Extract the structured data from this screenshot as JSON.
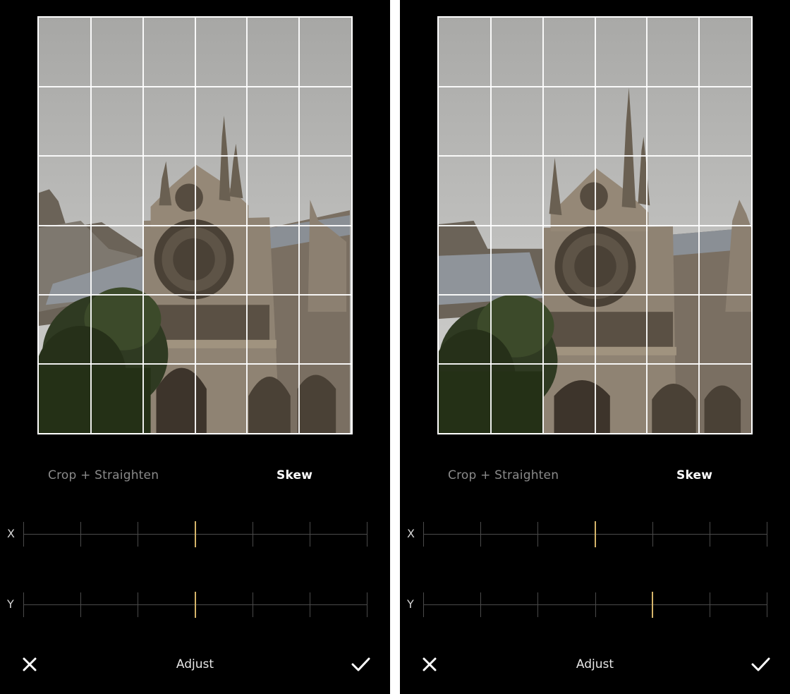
{
  "panels": [
    {
      "tabs": {
        "crop_straighten": "Crop + Straighten",
        "skew": "Skew",
        "active": "skew"
      },
      "sliders": [
        {
          "axis": "X",
          "value": 0
        },
        {
          "axis": "Y",
          "value": 0
        }
      ],
      "footer": {
        "title": "Adjust"
      }
    },
    {
      "tabs": {
        "crop_straighten": "Crop + Straighten",
        "skew": "Skew",
        "active": "skew"
      },
      "sliders": [
        {
          "axis": "X",
          "value": 0
        },
        {
          "axis": "Y",
          "value": 1
        }
      ],
      "footer": {
        "title": "Adjust"
      }
    }
  ],
  "icons": {
    "close": "close-icon",
    "confirm": "check-icon"
  },
  "colors": {
    "background": "#000000",
    "slider_thumb": "#d4b46a",
    "grid_lines": "#ffffff",
    "active_tab": "#ffffff",
    "inactive_tab": "#8a8a8a"
  }
}
